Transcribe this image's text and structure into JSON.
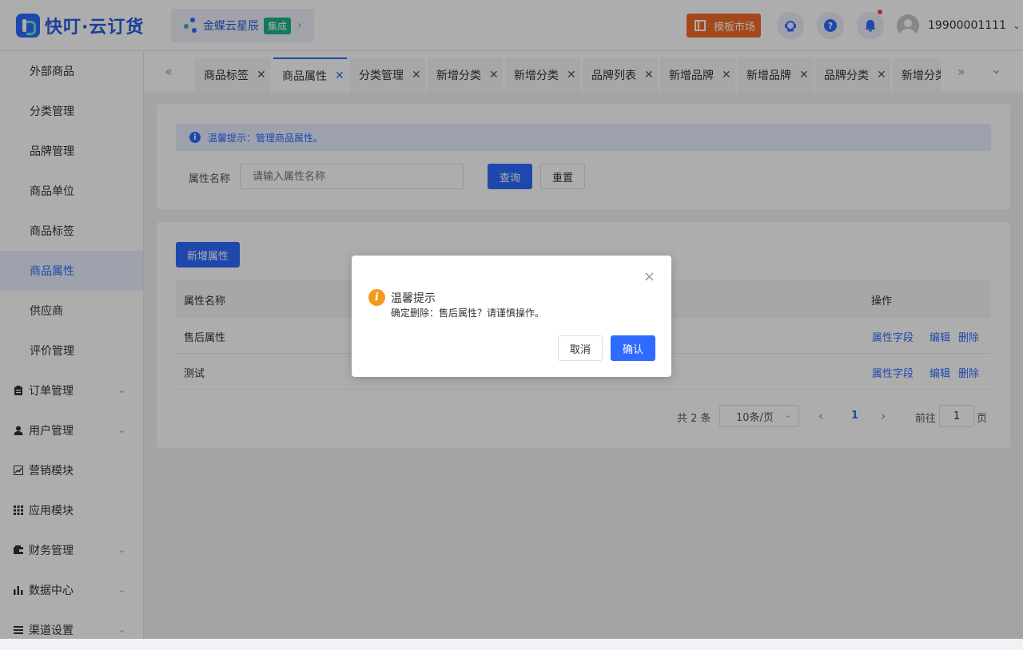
{
  "header": {
    "logo_text": "快叮·云订货",
    "brand": {
      "name": "金蝶云星辰",
      "badge": "集成",
      "chevron": "›"
    },
    "market_label": "模板市场",
    "icons": [
      "customer-service-icon",
      "help-icon",
      "bell-icon"
    ],
    "user_name": "19900001111",
    "user_chevron": "⌄",
    "colors": {
      "accent": "#2f6bff",
      "market": "#f26b2a",
      "badge": "#18b38b"
    }
  },
  "sidebar": {
    "items": [
      {
        "label": "外部商品"
      },
      {
        "label": "分类管理"
      },
      {
        "label": "品牌管理"
      },
      {
        "label": "商品单位"
      },
      {
        "label": "商品标签"
      },
      {
        "label": "商品属性",
        "active": true
      },
      {
        "label": "供应商"
      },
      {
        "label": "评价管理"
      }
    ],
    "groups": [
      {
        "label": "订单管理",
        "icon": "clipboard-icon"
      },
      {
        "label": "用户管理",
        "icon": "user-icon"
      },
      {
        "label": "营销模块",
        "icon": "trend-icon"
      },
      {
        "label": "应用模块",
        "icon": "grid-icon"
      },
      {
        "label": "财务管理",
        "icon": "wallet-icon"
      },
      {
        "label": "数据中心",
        "icon": "bar-chart-icon"
      },
      {
        "label": "渠道设置",
        "icon": "list-icon"
      }
    ]
  },
  "tabs": {
    "prev": "«",
    "next": "»",
    "more": "⌄",
    "items": [
      {
        "label": "商品标签"
      },
      {
        "label": "商品属性",
        "active": true
      },
      {
        "label": "分类管理"
      },
      {
        "label": "新增分类"
      },
      {
        "label": "新增分类"
      },
      {
        "label": "品牌列表"
      },
      {
        "label": "新增品牌"
      },
      {
        "label": "新增品牌"
      },
      {
        "label": "品牌分类"
      },
      {
        "label": "新增分类"
      }
    ]
  },
  "search": {
    "tip": "温馨提示：管理商品属性。",
    "field_label": "属性名称",
    "placeholder": "请输入属性名称",
    "query_label": "查询",
    "reset_label": "重置"
  },
  "table": {
    "add_label": "新增属性",
    "headers": {
      "name": "属性名称",
      "ops": "操作"
    },
    "rows": [
      {
        "name": "售后属性"
      },
      {
        "name": "测试"
      }
    ],
    "op_labels": {
      "fields": "属性字段",
      "edit": "编辑",
      "delete": "删除"
    }
  },
  "pagination": {
    "total": "共 2 条",
    "page_size": "10条/页",
    "current_page": "1",
    "goto_label": "前往",
    "goto_value": "1",
    "page_suffix": "页"
  },
  "dialog": {
    "title": "温馨提示",
    "message": "确定删除：售后属性？请谨慎操作。",
    "cancel_label": "取消",
    "confirm_label": "确认",
    "close_glyph": "×",
    "icon_glyph": "i"
  }
}
